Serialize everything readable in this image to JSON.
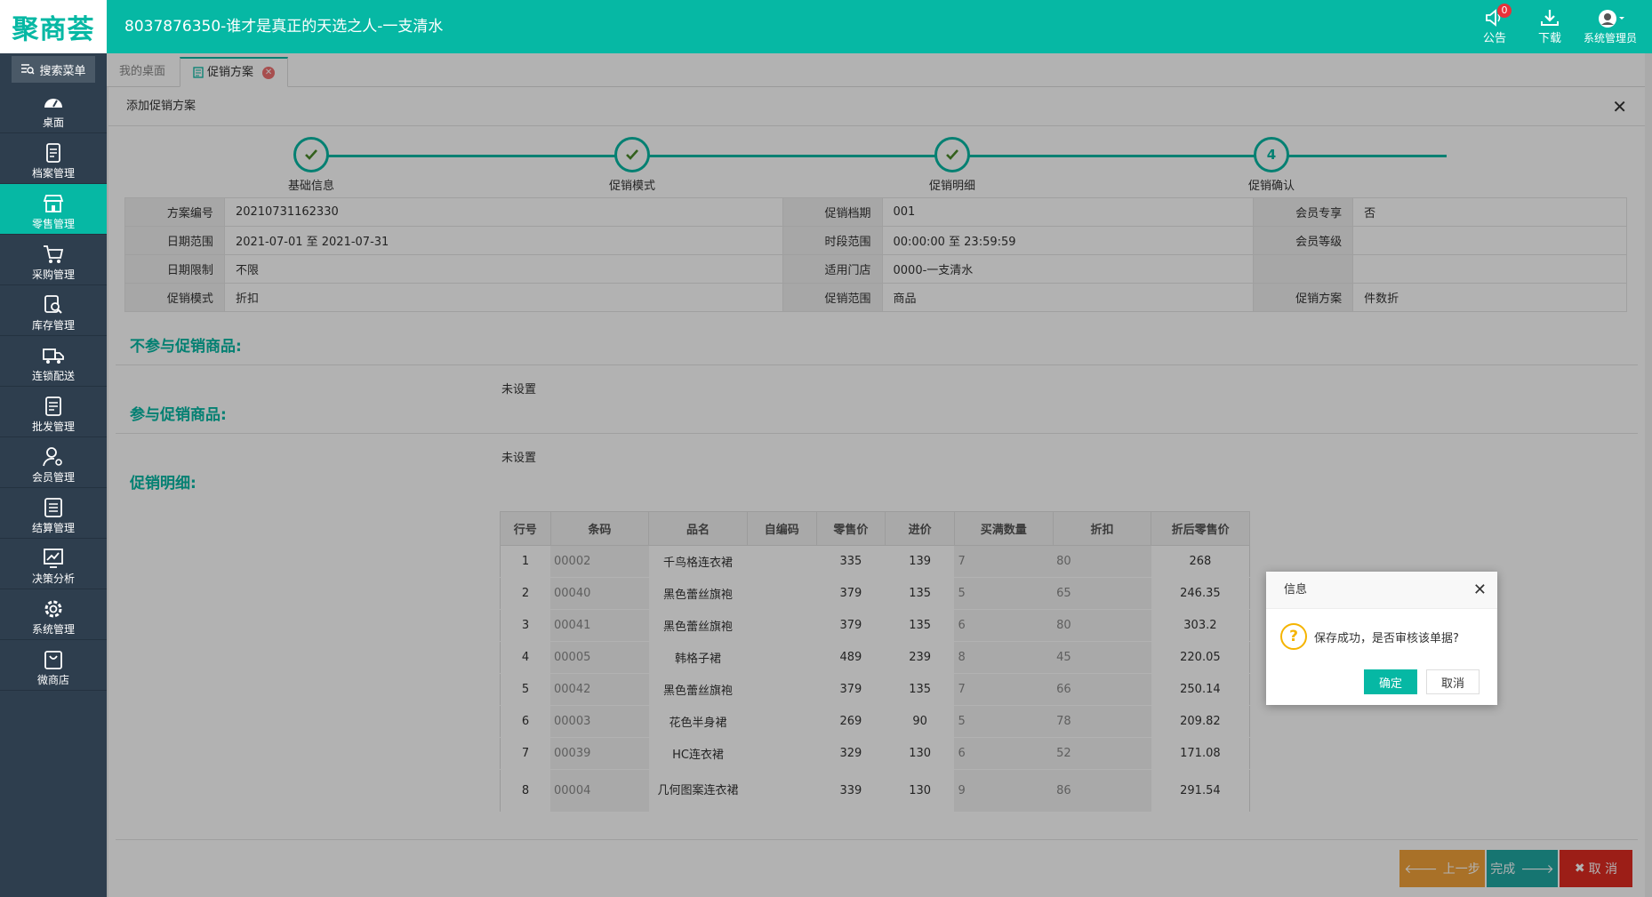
{
  "header": {
    "logo": "聚商荟",
    "store_title": "8037876350-谁才是真正的天选之人-一支清水",
    "announce_label": "公告",
    "announce_count": "0",
    "download_label": "下载",
    "user_label": "系统管理员"
  },
  "sidebar": {
    "search_label": "搜索菜单",
    "items": [
      {
        "label": "桌面",
        "icon": "dashboard-icon"
      },
      {
        "label": "档案管理",
        "icon": "archive-icon"
      },
      {
        "label": "零售管理",
        "icon": "store-icon"
      },
      {
        "label": "采购管理",
        "icon": "cart-icon"
      },
      {
        "label": "库存管理",
        "icon": "inventory-icon"
      },
      {
        "label": "连锁配送",
        "icon": "truck-icon"
      },
      {
        "label": "批发管理",
        "icon": "wholesale-icon"
      },
      {
        "label": "会员管理",
        "icon": "member-icon"
      },
      {
        "label": "结算管理",
        "icon": "settlement-icon"
      },
      {
        "label": "决策分析",
        "icon": "analytics-icon"
      },
      {
        "label": "系统管理",
        "icon": "gear-icon"
      },
      {
        "label": "微商店",
        "icon": "bag-icon"
      }
    ]
  },
  "tabs": {
    "desktop": "我的桌面",
    "promotion": "促销方案"
  },
  "panel": {
    "title": "添加促销方案",
    "steps": [
      "基础信息",
      "促销模式",
      "促销明细",
      "促销确认"
    ],
    "step4_num": "4",
    "info": {
      "r1": [
        "方案编号",
        "20210731162330",
        "促销档期",
        "001",
        "会员专享",
        "否"
      ],
      "r2": [
        "日期范围",
        "2021-07-01 至 2021-07-31",
        "时段范围",
        "00:00:00 至 23:59:59",
        "会员等级",
        ""
      ],
      "r3": [
        "日期限制",
        "不限",
        "适用门店",
        "0000-一支清水",
        "",
        ""
      ],
      "r4": [
        "促销模式",
        "折扣",
        "促销范围",
        "商品",
        "促销方案",
        "件数折"
      ]
    },
    "sections": {
      "exclude_title": "不参与促销商品:",
      "exclude_value": "未设置",
      "include_title": "参与促销商品:",
      "include_value": "未设置",
      "detail_title": "促销明细:"
    },
    "detail_headers": [
      "行号",
      "条码",
      "品名",
      "自编码",
      "零售价",
      "进价",
      "买满数量",
      "折扣",
      "折后零售价"
    ],
    "detail_rows": [
      [
        "1",
        "00002",
        "千鸟格连衣裙",
        "",
        "335",
        "139",
        "7",
        "80",
        "268"
      ],
      [
        "2",
        "00040",
        "黑色蕾丝旗袍",
        "",
        "379",
        "135",
        "5",
        "65",
        "246.35"
      ],
      [
        "3",
        "00041",
        "黑色蕾丝旗袍",
        "",
        "379",
        "135",
        "6",
        "80",
        "303.2"
      ],
      [
        "4",
        "00005",
        "韩格子裙",
        "",
        "489",
        "239",
        "8",
        "45",
        "220.05"
      ],
      [
        "5",
        "00042",
        "黑色蕾丝旗袍",
        "",
        "379",
        "135",
        "7",
        "66",
        "250.14"
      ],
      [
        "6",
        "00003",
        "花色半身裙",
        "",
        "269",
        "90",
        "5",
        "78",
        "209.82"
      ],
      [
        "7",
        "00039",
        "HC连衣裙",
        "",
        "329",
        "130",
        "6",
        "52",
        "171.08"
      ],
      [
        "8",
        "00004",
        "几何图案连衣裙",
        "",
        "339",
        "130",
        "9",
        "86",
        "291.54"
      ]
    ],
    "buttons": {
      "prev": "上一步",
      "done": "完成",
      "cancel": "取 消"
    }
  },
  "dialog": {
    "title": "信息",
    "message": "保存成功，是否审核该单据?",
    "ok": "确定",
    "cancel": "取消"
  },
  "colors": {
    "accent": "#06b8a4",
    "sidebar_bg": "#2e3e4e",
    "prev_btn": "#f2a33a",
    "cancel_btn": "#e02c22"
  }
}
